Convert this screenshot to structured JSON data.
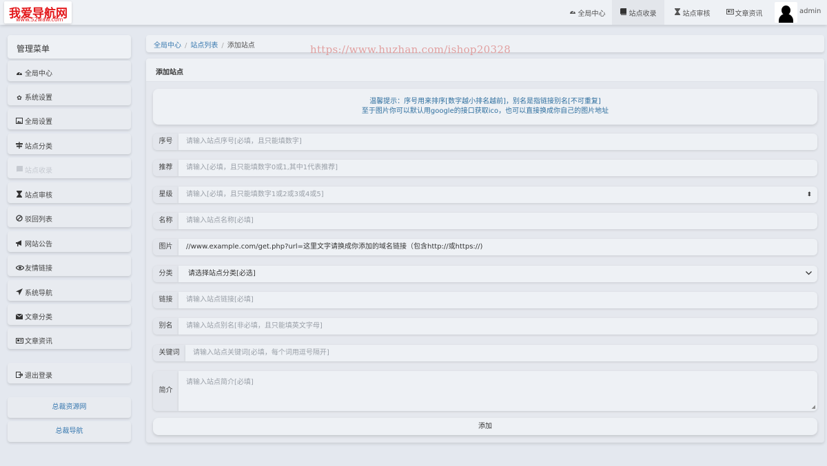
{
  "header": {
    "logo_title": "我爱导航网",
    "logo_sub": "www.52waw.com",
    "nav": [
      {
        "label": "全局中心",
        "icon": "dashboard-icon"
      },
      {
        "label": "站点收录",
        "icon": "book-icon"
      },
      {
        "label": "站点审核",
        "icon": "hourglass-icon"
      },
      {
        "label": "文章资讯",
        "icon": "newspaper-icon"
      }
    ],
    "active_nav": "站点收录",
    "user": "admin"
  },
  "sidebar": {
    "title": "管理菜单",
    "items": [
      {
        "label": "全局中心",
        "icon": "dashboard-icon"
      },
      {
        "label": "系统设置",
        "icon": "gear-icon"
      },
      {
        "label": "全局设置",
        "icon": "picture-icon"
      },
      {
        "label": "站点分类",
        "icon": "signpost-icon"
      },
      {
        "label": "站点收录",
        "icon": "book-icon"
      },
      {
        "label": "站点审核",
        "icon": "hourglass-icon"
      },
      {
        "label": "驳回列表",
        "icon": "ban-icon"
      },
      {
        "label": "网站公告",
        "icon": "bullhorn-icon"
      },
      {
        "label": "友情链接",
        "icon": "eye-icon"
      },
      {
        "label": "系统导航",
        "icon": "send-icon"
      },
      {
        "label": "文章分类",
        "icon": "envelope-icon"
      },
      {
        "label": "文章资讯",
        "icon": "newspaper-icon"
      }
    ],
    "active_item": "站点收录",
    "logout": "退出登录",
    "links": [
      "总裁资源网",
      "总裁导航"
    ]
  },
  "breadcrumb": {
    "items": [
      "全局中心",
      "站点列表"
    ],
    "current": "添加站点"
  },
  "watermark": "https://www.huzhan.com/ishop20328",
  "panel": {
    "title": "添加站点",
    "tip_line1": "温馨提示：序号用来排序[数字越小排名越前]，别名是指链接别名[不可重复]",
    "tip_line2": "至于图片你可以默认用google的接口获取ico，也可以直接换成你自己的图片地址"
  },
  "form": {
    "order": {
      "label": "序号",
      "placeholder": "请输入站点序号[必填，且只能填数字]"
    },
    "recommend": {
      "label": "推荐",
      "placeholder": "请输入[必填，且只能填数字0或1,其中1代表推荐]"
    },
    "star": {
      "label": "星级",
      "placeholder": "请输入[必填，且只能填数字1或2或3或4或5]"
    },
    "name": {
      "label": "名称",
      "placeholder": "请输入站点名称[必填]"
    },
    "image": {
      "label": "图片",
      "value": "//www.example.com/get.php?url=这里文字请换成你添加的域名链接（包含http://或https://)"
    },
    "category": {
      "label": "分类",
      "selected": "请选择站点分类[必选]"
    },
    "link": {
      "label": "链接",
      "placeholder": "请输入站点链接[必填]"
    },
    "alias": {
      "label": "别名",
      "placeholder": "请输入站点别名[非必填，且只能填英文字母]"
    },
    "keywords": {
      "label": "关键词",
      "placeholder": "请输入站点关键词[必填，每个词用逗号隔开]"
    },
    "intro": {
      "label": "简介",
      "placeholder": "请输入站点简介[必填]"
    },
    "submit": "添加"
  }
}
